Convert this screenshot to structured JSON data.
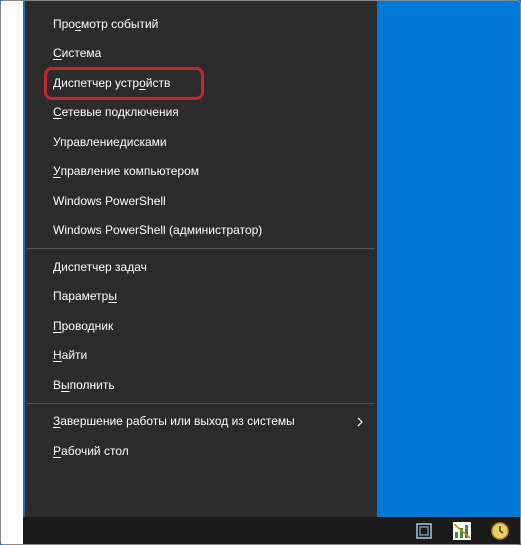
{
  "menu": {
    "items": [
      {
        "label": "Просмотр событий",
        "u": "с",
        "pre": "Про",
        "post": "мотр событий"
      },
      {
        "label": "Система",
        "u": "С",
        "pre": "",
        "post": "истема"
      },
      {
        "label": "Диспетчер устройств",
        "u": "о",
        "pre": "Диспетчер устр",
        "post": "йств",
        "highlight": true
      },
      {
        "label": "Сетевые подключения",
        "u": "С",
        "pre": "",
        "post": "етевые подключения"
      },
      {
        "label": "Управление дисками",
        "u": "д",
        "pre": "Управление ",
        "post": "исками"
      },
      {
        "label": "Управление компьютером",
        "u": "У",
        "pre": "",
        "post": "правление компьютером"
      },
      {
        "label": "Windows PowerShell",
        "plain": true
      },
      {
        "label": "Windows PowerShell (администратор)",
        "plain": true
      },
      {
        "sep": true
      },
      {
        "label": "Диспетчер задач",
        "u": "Д",
        "pre": "",
        "post": "испетчер задач"
      },
      {
        "label": "Параметры",
        "u": "ы",
        "pre": "Параметр",
        "post": ""
      },
      {
        "label": "Проводник",
        "u": "П",
        "pre": "",
        "post": "роводник"
      },
      {
        "label": "Найти",
        "u": "Н",
        "pre": "",
        "post": "айти"
      },
      {
        "label": "Выполнить",
        "u": "ы",
        "pre": "В",
        "post": "полнить"
      },
      {
        "sep": true
      },
      {
        "label": "Завершение работы или выход из системы",
        "u": "З",
        "pre": "",
        "post": "авершение работы или выход из системы",
        "arrow": true
      },
      {
        "label": "Рабочий стол",
        "u": "Р",
        "pre": "",
        "post": "абочий стол"
      }
    ]
  },
  "taskbar": {
    "icons": [
      "vbox-icon",
      "chart-icon",
      "clock-icon"
    ]
  },
  "labels": {
    "highlight_target": "device-manager"
  }
}
